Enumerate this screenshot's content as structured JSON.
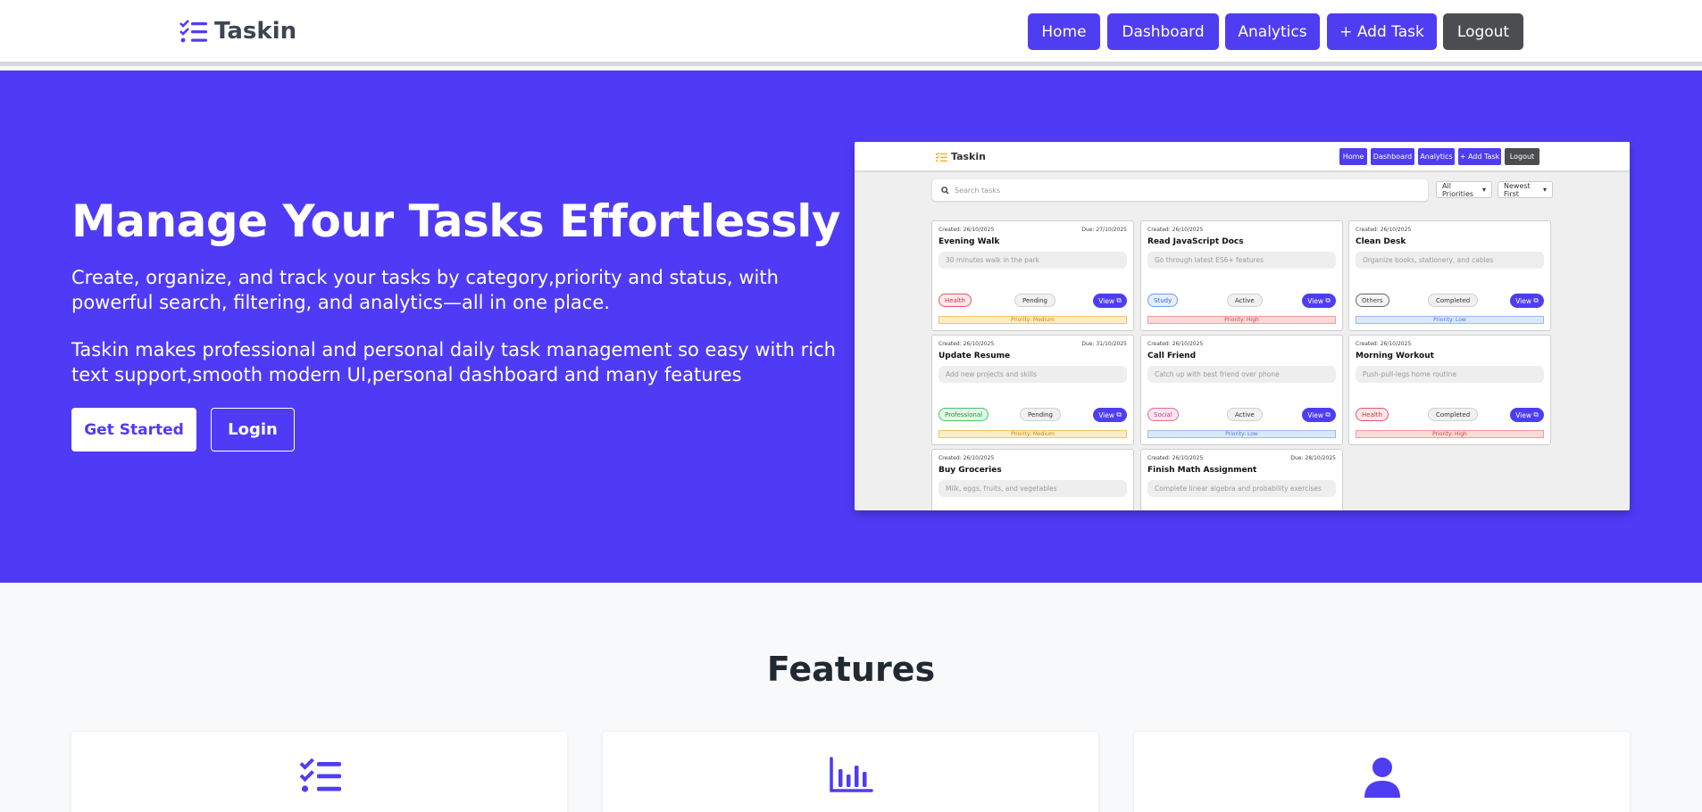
{
  "navbar": {
    "brand": "Taskin",
    "links": [
      "Home",
      "Dashboard",
      "Analytics",
      "+ Add Task",
      "Logout"
    ]
  },
  "hero": {
    "title": "Manage Your Tasks Effortlessly",
    "paragraph1": "Create, organize, and track your tasks by category,priority and status, with powerful search, filtering, and analytics—all in one place.",
    "paragraph2": "Taskin makes professional and personal daily task management so easy with rich text support,smooth modern UI,personal dashboard and many features",
    "get_started": "Get Started",
    "login": "Login"
  },
  "preview": {
    "brand": "Taskin",
    "nav": [
      "Home",
      "Dashboard",
      "Analytics",
      "+ Add Task",
      "Logout"
    ],
    "search_placeholder": "Search tasks",
    "filter_priority": "All Priorities",
    "sort": "Newest First",
    "cards": [
      {
        "created": "Created: 26/10/2025",
        "due": "Due: 27/10/2025",
        "title": "Evening Walk",
        "desc": "30 minutes walk in the park",
        "category": "Health",
        "status": "Pending",
        "view": "View",
        "priority": "Priority: Medium"
      },
      {
        "created": "Created: 26/10/2025",
        "due": "",
        "title": "Read JavaScript Docs",
        "desc": "Go through latest ES6+ features",
        "category": "Study",
        "status": "Active",
        "view": "View",
        "priority": "Priority: High"
      },
      {
        "created": "Created: 26/10/2025",
        "due": "",
        "title": "Clean Desk",
        "desc": "Organize books, stationery, and cables",
        "category": "Others",
        "status": "Completed",
        "view": "View",
        "priority": "Priority: Low"
      },
      {
        "created": "Created: 26/10/2025",
        "due": "Due: 31/10/2025",
        "title": "Update Resume",
        "desc": "Add new projects and skills",
        "category": "Professional",
        "status": "Pending",
        "view": "View",
        "priority": "Priority: Medium"
      },
      {
        "created": "Created: 26/10/2025",
        "due": "",
        "title": "Call Friend",
        "desc": "Catch up with best friend over phone",
        "category": "Social",
        "status": "Active",
        "view": "View",
        "priority": "Priority: Low"
      },
      {
        "created": "Created: 26/10/2025",
        "due": "",
        "title": "Morning Workout",
        "desc": "Push-pull-legs home routine",
        "category": "Health",
        "status": "Completed",
        "view": "View",
        "priority": "Priority: High"
      },
      {
        "created": "Created: 26/10/2025",
        "due": "",
        "title": "Buy Groceries",
        "desc": "Milk, eggs, fruits, and vegetables",
        "category": "",
        "status": "",
        "view": "",
        "priority": ""
      },
      {
        "created": "Created: 26/10/2025",
        "due": "Due: 28/10/2025",
        "title": "Finish Math Assignment",
        "desc": "Complete linear algebra and probability exercises",
        "category": "",
        "status": "",
        "view": "",
        "priority": ""
      }
    ]
  },
  "features": {
    "title": "Features",
    "icons": [
      "task-list-icon",
      "bar-chart-icon",
      "user-icon"
    ]
  },
  "colors": {
    "primary": "#4f3bf5",
    "dark_button": "#4b4d51",
    "brand_icon": "#4f3df2",
    "preview_brand_icon": "#f0b429"
  }
}
